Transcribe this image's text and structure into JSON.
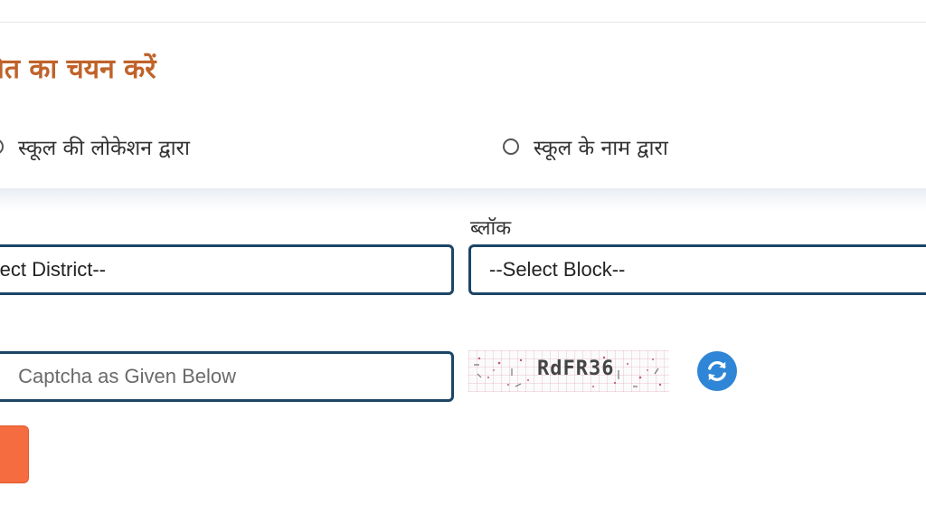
{
  "form": {
    "heading": "चित का चयन करें",
    "search_options": [
      {
        "label": "स्कूल की लोकेशन द्वारा",
        "selected": false
      },
      {
        "label": "स्कूल के नाम द्वारा",
        "selected": false
      }
    ],
    "block_label": "ब्लॉक",
    "district_select": {
      "value": "ect District--"
    },
    "block_select": {
      "value": "--Select Block--"
    },
    "captcha_input": {
      "placeholder": "Captcha as Given Below"
    },
    "captcha": {
      "code": "RdFR36"
    },
    "refresh_icon": "refresh-icon"
  },
  "colors": {
    "heading": "#c0622a",
    "field_border": "#1c4566",
    "refresh_button": "#2f86d6",
    "submit_button": "#f46c3f"
  }
}
